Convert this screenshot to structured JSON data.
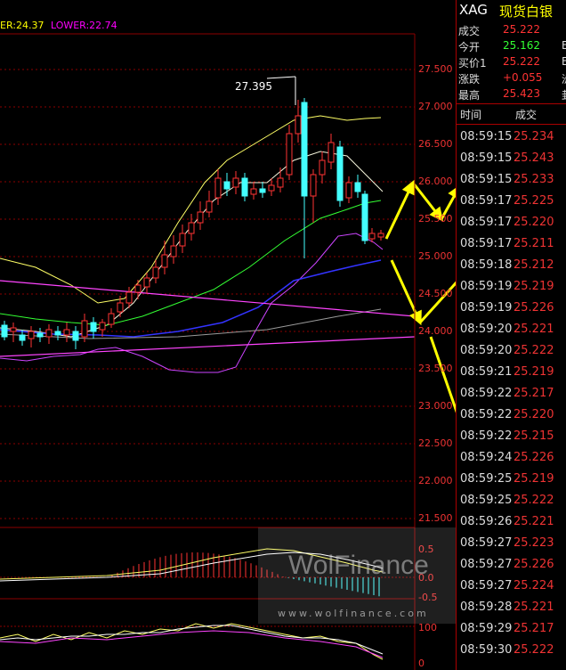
{
  "indicators": {
    "upper_label": "ER:24.37",
    "lower_label": "LOWER:22.74"
  },
  "colors": {
    "upper_color": "#ffff00",
    "lower_color": "#ff00ff",
    "axis_color": "#e33333",
    "grid_color": "#8b0000",
    "up_candle": "#ff3333",
    "down_candle": "#44ffff",
    "arrow_color": "#ffff00"
  },
  "price_axis": {
    "ticks": [
      "27.500",
      "27.000",
      "26.500",
      "26.000",
      "25.500",
      "25.000",
      "24.500",
      "24.000",
      "23.500",
      "23.000",
      "22.500",
      "22.000",
      "21.500"
    ]
  },
  "chart": {
    "peak_label": "27.395"
  },
  "macd_axis": {
    "ticks": [
      "0.5",
      "0.0",
      "-0.5"
    ]
  },
  "osc_axis": {
    "ticks": [
      "100",
      "0"
    ]
  },
  "watermark": {
    "title": "WolFinance",
    "url": "www.wolfinance.com"
  },
  "panel": {
    "symbol": "XAG",
    "name": "现货白银",
    "quote": [
      {
        "label": "成交",
        "value": "25.222",
        "color": "#ff3333",
        "trunc": ""
      },
      {
        "label": "今开",
        "value": "25.162",
        "color": "#33ff33",
        "trunc": "Е"
      },
      {
        "label": "买价1",
        "value": "25.222",
        "color": "#ff3333",
        "trunc": "Ε"
      },
      {
        "label": "涨跌",
        "value": "+0.055",
        "color": "#ff3333",
        "trunc": "洲"
      },
      {
        "label": "最高",
        "value": "25.423",
        "color": "#ff3333",
        "trunc": "卦"
      }
    ],
    "tick_header": {
      "time": "时间",
      "price": "成交"
    },
    "ticks": [
      {
        "time": "08:59:15",
        "price": "25.234"
      },
      {
        "time": "08:59:15",
        "price": "25.243"
      },
      {
        "time": "08:59:15",
        "price": "25.233"
      },
      {
        "time": "08:59:17",
        "price": "25.225"
      },
      {
        "time": "08:59:17",
        "price": "25.220"
      },
      {
        "time": "08:59:17",
        "price": "25.211"
      },
      {
        "time": "08:59:18",
        "price": "25.212"
      },
      {
        "time": "08:59:19",
        "price": "25.219"
      },
      {
        "time": "08:59:19",
        "price": "25.226"
      },
      {
        "time": "08:59:20",
        "price": "25.221"
      },
      {
        "time": "08:59:20",
        "price": "25.222"
      },
      {
        "time": "08:59:21",
        "price": "25.219"
      },
      {
        "time": "08:59:22",
        "price": "25.217"
      },
      {
        "time": "08:59:22",
        "price": "25.220"
      },
      {
        "time": "08:59:22",
        "price": "25.215"
      },
      {
        "time": "08:59:24",
        "price": "25.226"
      },
      {
        "time": "08:59:25",
        "price": "25.219"
      },
      {
        "time": "08:59:25",
        "price": "25.222"
      },
      {
        "time": "08:59:26",
        "price": "25.221"
      },
      {
        "time": "08:59:27",
        "price": "25.223"
      },
      {
        "time": "08:59:27",
        "price": "25.226"
      },
      {
        "time": "08:59:27",
        "price": "25.224"
      },
      {
        "time": "08:59:28",
        "price": "25.221"
      },
      {
        "time": "08:59:29",
        "price": "25.217"
      },
      {
        "time": "08:59:30",
        "price": "25.222"
      }
    ]
  }
}
